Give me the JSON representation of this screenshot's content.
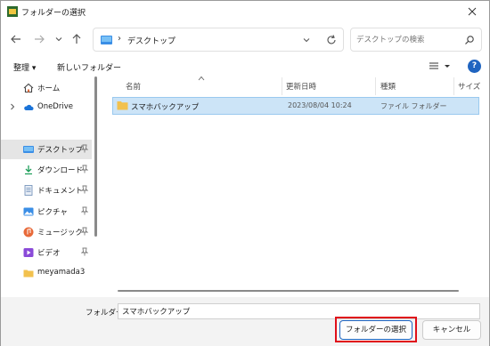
{
  "window": {
    "title": "フォルダーの選択"
  },
  "address": {
    "path": "デスクトップ"
  },
  "search": {
    "placeholder": "デスクトップの検索"
  },
  "toolbar": {
    "organize": "整理 ▾",
    "new_folder": "新しいフォルダー"
  },
  "sidebar": {
    "items": [
      {
        "label": "ホーム",
        "icon": "home-icon"
      },
      {
        "label": "OneDrive",
        "icon": "cloud-icon"
      },
      {
        "label": "デスクトップ",
        "icon": "desktop-icon",
        "selected": true,
        "pinned": true
      },
      {
        "label": "ダウンロード",
        "icon": "download-icon",
        "pinned": true
      },
      {
        "label": "ドキュメント",
        "icon": "document-icon",
        "pinned": true
      },
      {
        "label": "ピクチャ",
        "icon": "pictures-icon",
        "pinned": true
      },
      {
        "label": "ミュージック",
        "icon": "music-icon",
        "pinned": true
      },
      {
        "label": "ビデオ",
        "icon": "video-icon",
        "pinned": true
      },
      {
        "label": "meyamada3",
        "icon": "folder-icon"
      }
    ]
  },
  "columns": {
    "name": "名前",
    "modified": "更新日時",
    "type": "種類",
    "size": "サイズ"
  },
  "files": [
    {
      "name": "スマホバックアップ",
      "modified": "2023/08/04 10:24",
      "type": "ファイル フォルダー"
    }
  ],
  "footer": {
    "folder_label": "フォルダー:",
    "folder_value": "スマホバックアップ",
    "select_button": "フォルダーの選択",
    "cancel_button": "キャンセル"
  },
  "colors": {
    "selection": "#cce4f7",
    "highlight": "#e0101a",
    "accent": "#1f64c0"
  }
}
